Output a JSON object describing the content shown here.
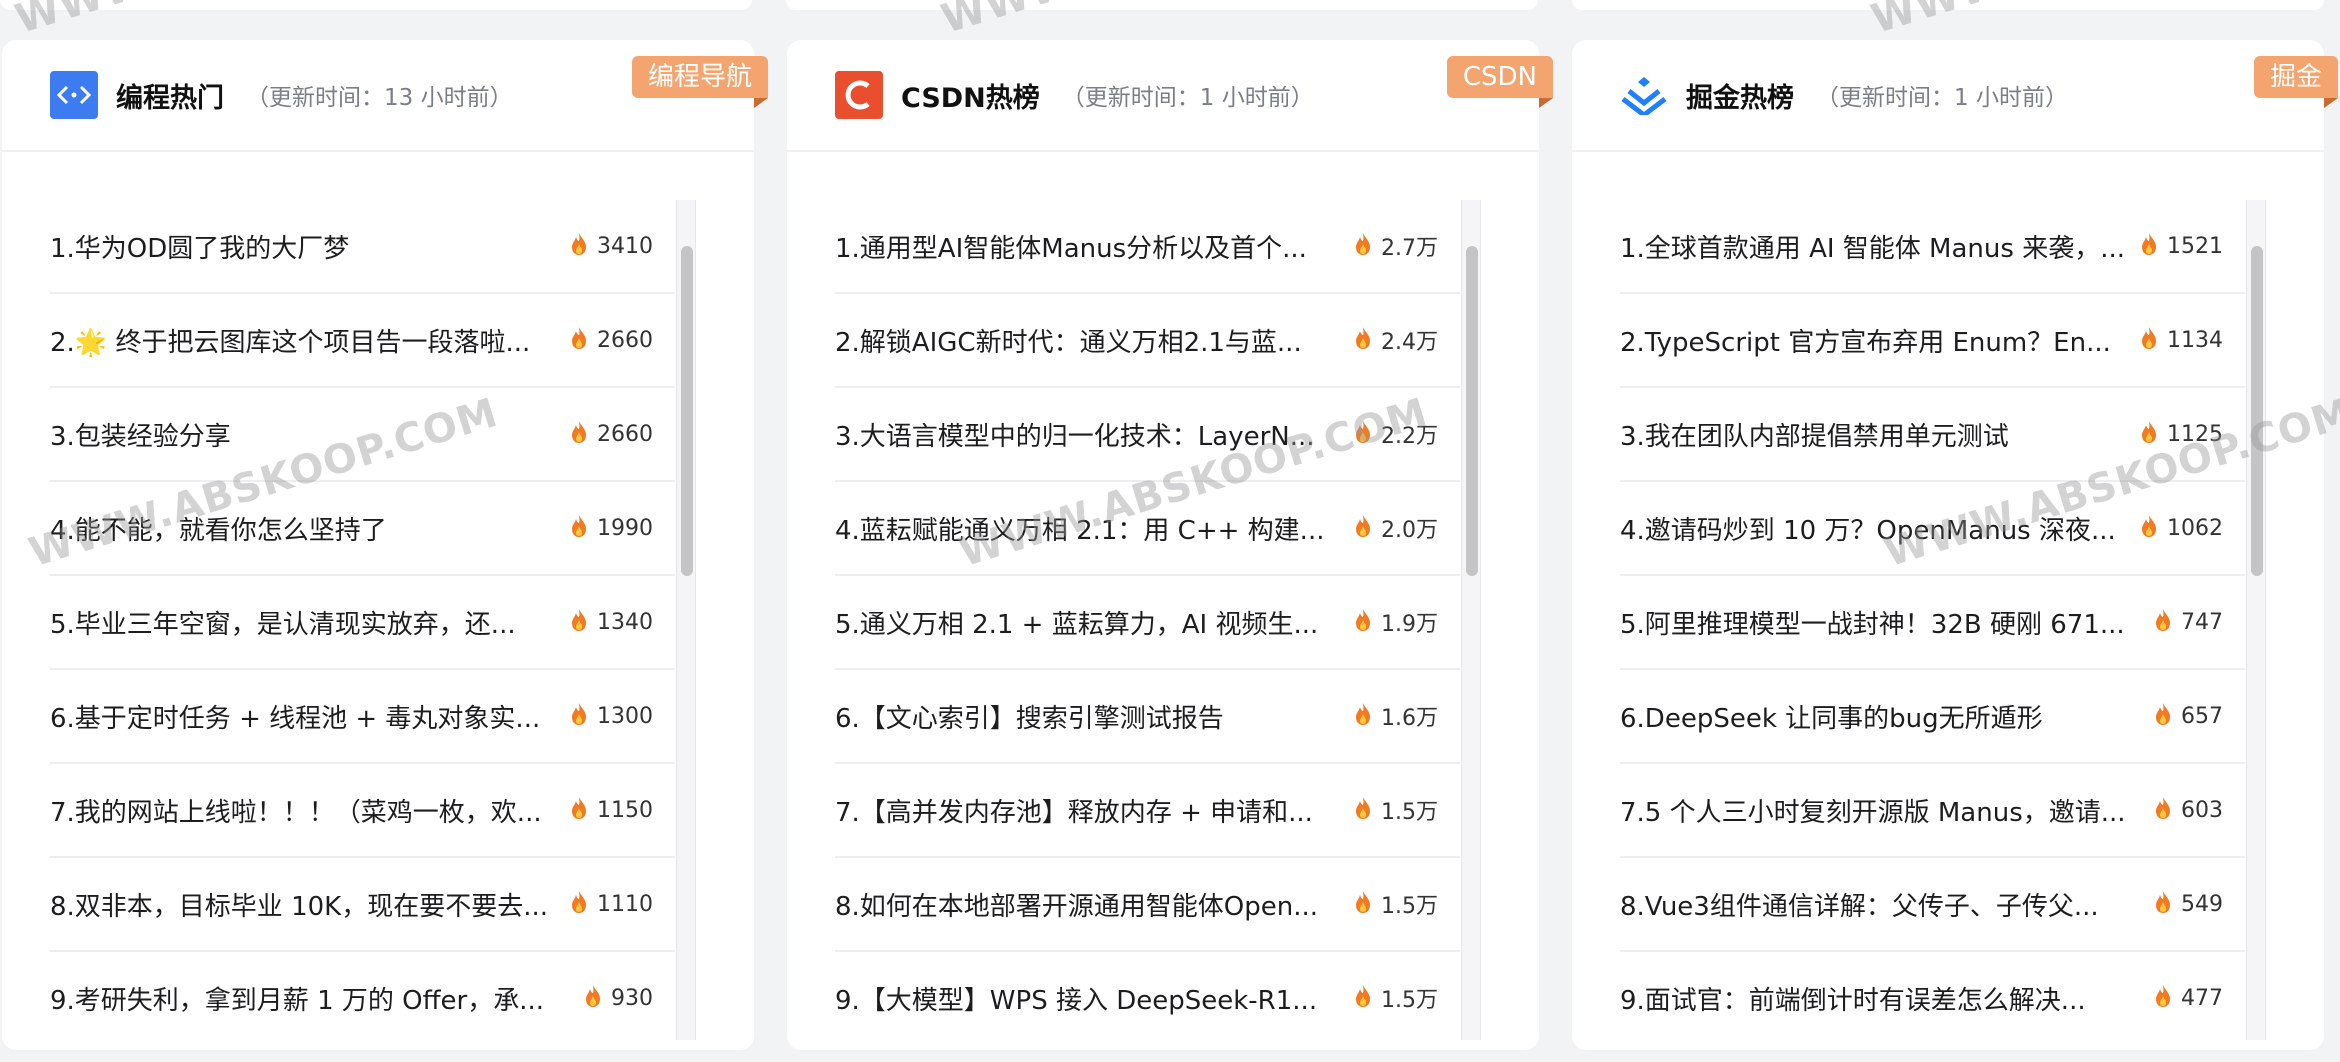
{
  "watermark_text": "WWW.ABSKOOP.COM",
  "watermark_top_fragment": "WWW",
  "fire_icon": "fire-icon",
  "colors": {
    "accent_tag": "#f3a46f",
    "hot_fire": "#f37a22",
    "csdn_red": "#e94f2e",
    "juejin_blue": "#1e80ff",
    "programming_blue": "#3d7cf0"
  },
  "cards": [
    {
      "logo_icon": "code-icon",
      "title": "编程热门",
      "update": "（更新时间：13 小时前）",
      "tag": "编程导航",
      "items": [
        {
          "title": "1.华为OD圆了我的大厂梦",
          "hot": "3410"
        },
        {
          "title": "2.🌟 终于把云图库这个项目告一段落啦...",
          "hot": "2660"
        },
        {
          "title": "3.包装经验分享",
          "hot": "2660"
        },
        {
          "title": "4.能不能，就看你怎么坚持了",
          "hot": "1990"
        },
        {
          "title": "5.毕业三年空窗，是认清现实放弃，还...",
          "hot": "1340"
        },
        {
          "title": "6.基于定时任务 + 线程池 + 毒丸对象实...",
          "hot": "1300"
        },
        {
          "title": "7.我的网站上线啦！！！（菜鸡一枚，欢...",
          "hot": "1150"
        },
        {
          "title": "8.双非本，目标毕业 10K，现在要不要去...",
          "hot": "1110"
        },
        {
          "title": "9.考研失利，拿到月薪 1 万的 Offer，承...",
          "hot": "930"
        }
      ]
    },
    {
      "logo_icon": "csdn-logo-icon",
      "title": "CSDN热榜",
      "update": "（更新时间：1 小时前）",
      "tag": "CSDN",
      "items": [
        {
          "title": "1.通用型AI智能体Manus分析以及首个...",
          "hot": "2.7万"
        },
        {
          "title": "2.解锁AIGC新时代：通义万相2.1与蓝...",
          "hot": "2.4万"
        },
        {
          "title": "3.大语言模型中的归一化技术：LayerN...",
          "hot": "2.2万"
        },
        {
          "title": "4.蓝耘赋能通义万相 2.1：用 C++ 构建...",
          "hot": "2.0万"
        },
        {
          "title": "5.通义万相 2.1 + 蓝耘算力，AI 视频生...",
          "hot": "1.9万"
        },
        {
          "title": "6.【文心索引】搜索引擎测试报告",
          "hot": "1.6万"
        },
        {
          "title": "7.【高并发内存池】释放内存 + 申请和...",
          "hot": "1.5万"
        },
        {
          "title": "8.如何在本地部署开源通用智能体Open...",
          "hot": "1.5万"
        },
        {
          "title": "9.【大模型】WPS 接入 DeepSeek-R1...",
          "hot": "1.5万"
        }
      ]
    },
    {
      "logo_icon": "juejin-logo-icon",
      "title": "掘金热榜",
      "update": "（更新时间：1 小时前）",
      "tag": "掘金",
      "items": [
        {
          "title": "1.全球首款通用 AI 智能体 Manus 来袭，...",
          "hot": "1521"
        },
        {
          "title": "2.TypeScript 官方宣布弃用 Enum？En...",
          "hot": "1134"
        },
        {
          "title": "3.我在团队内部提倡禁用单元测试",
          "hot": "1125"
        },
        {
          "title": "4.邀请码炒到 10 万？OpenManus 深夜...",
          "hot": "1062"
        },
        {
          "title": "5.阿里推理模型一战封神！32B 硬刚 671...",
          "hot": "747"
        },
        {
          "title": "6.DeepSeek 让同事的bug无所遁形",
          "hot": "657"
        },
        {
          "title": "7.5 个人三小时复刻开源版 Manus，邀请...",
          "hot": "603"
        },
        {
          "title": "8.Vue3组件通信详解：父传子、子传父...",
          "hot": "549"
        },
        {
          "title": "9.面试官：前端倒计时有误差怎么解决...",
          "hot": "477"
        }
      ]
    }
  ]
}
